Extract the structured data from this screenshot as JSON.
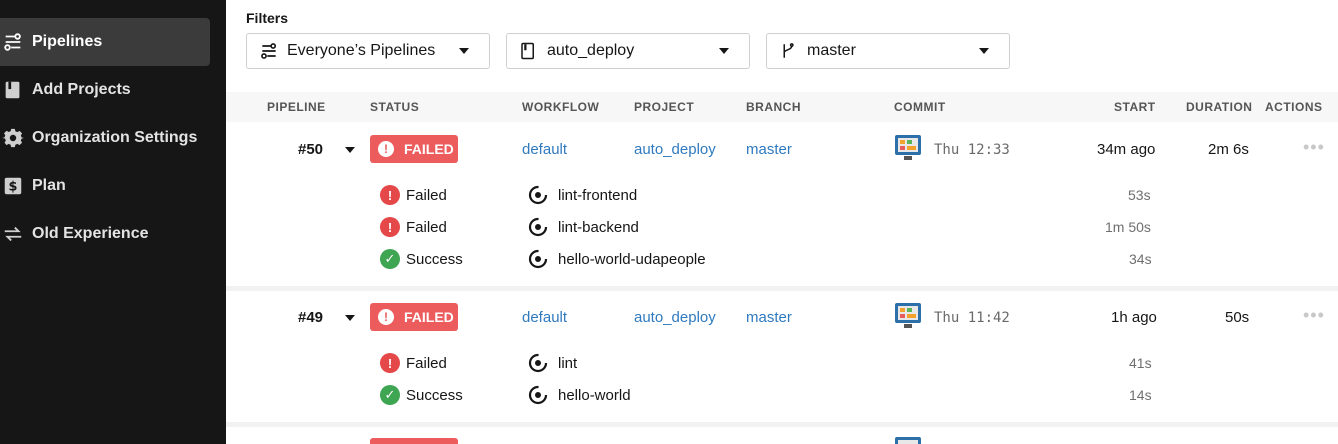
{
  "sidebar": {
    "items": [
      {
        "label": "Pipelines",
        "icon": "pipelines-icon",
        "active": true
      },
      {
        "label": "Add Projects",
        "icon": "book-icon"
      },
      {
        "label": "Organization Settings",
        "icon": "gear-icon"
      },
      {
        "label": "Plan",
        "icon": "dollar-icon"
      },
      {
        "label": "Old Experience",
        "icon": "swap-arrows-icon"
      }
    ]
  },
  "filters": {
    "label": "Filters",
    "pipelines": "Everyone’s Pipelines",
    "project": "auto_deploy",
    "branch": "master"
  },
  "table": {
    "headers": {
      "pipeline": "PIPELINE",
      "status": "STATUS",
      "workflow": "WORKFLOW",
      "project": "PROJECT",
      "branch": "BRANCH",
      "commit": "COMMIT",
      "start": "START",
      "duration": "DURATION",
      "actions": "ACTIONS"
    },
    "pipelines": [
      {
        "number": "#50",
        "status": "FAILED",
        "workflow": "default",
        "project": "auto_deploy",
        "branch": "master",
        "commit_time": "Thu 12:33",
        "start": "34m ago",
        "duration": "2m 6s",
        "jobs": [
          {
            "status": "Failed",
            "name": "lint-frontend",
            "duration": "53s"
          },
          {
            "status": "Failed",
            "name": "lint-backend",
            "duration": "1m 50s"
          },
          {
            "status": "Success",
            "name": "hello-world-udapeople",
            "duration": "34s"
          }
        ]
      },
      {
        "number": "#49",
        "status": "FAILED",
        "workflow": "default",
        "project": "auto_deploy",
        "branch": "master",
        "commit_time": "Thu 11:42",
        "start": "1h ago",
        "duration": "50s",
        "jobs": [
          {
            "status": "Failed",
            "name": "lint",
            "duration": "41s"
          },
          {
            "status": "Success",
            "name": "hello-world",
            "duration": "14s"
          }
        ]
      }
    ]
  },
  "colors": {
    "sidebar_bg": "#161616",
    "failed": "#ed5c5c",
    "success": "#3ea552",
    "link": "#2f7abf"
  }
}
